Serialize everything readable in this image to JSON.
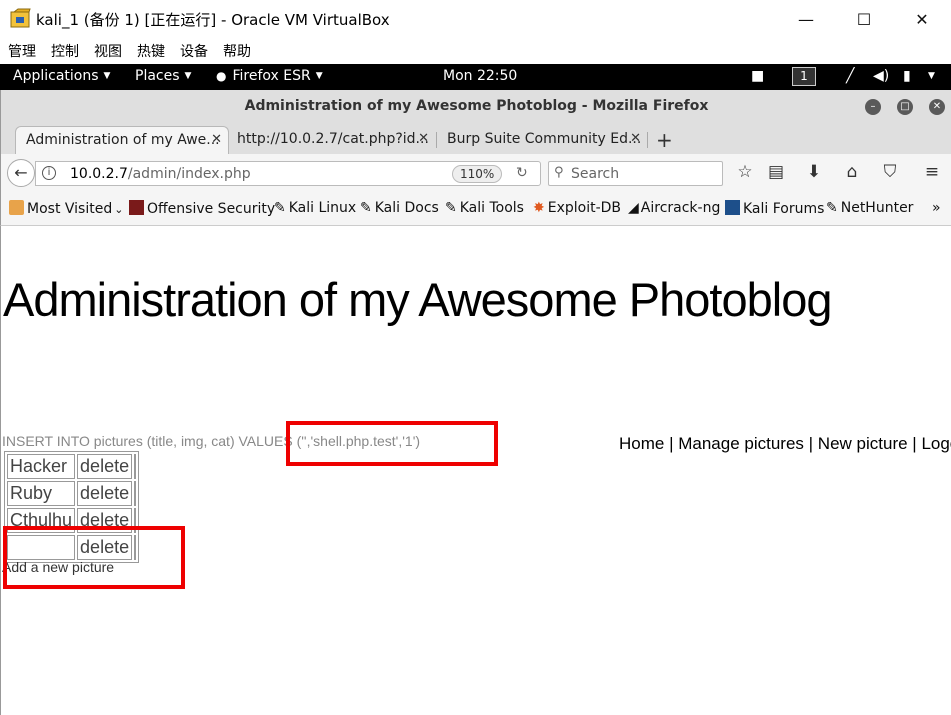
{
  "vbox": {
    "title": "kali_1 (备份 1) [正在运行] - Oracle VM VirtualBox",
    "menu": [
      "管理",
      "控制",
      "视图",
      "热键",
      "设备",
      "帮助"
    ],
    "minimize": "—",
    "maximize": "☐",
    "close": "✕"
  },
  "gnome": {
    "applications": "Applications",
    "places": "Places",
    "firefox": "Firefox ESR",
    "clock": "Mon 22:50",
    "workspace": "1"
  },
  "firefox": {
    "window_title": "Administration of my Awesome Photoblog - Mozilla Firefox",
    "tabs": [
      {
        "label": "Administration of my Awe..."
      },
      {
        "label": "http://10.0.2.7/cat.php?id..."
      },
      {
        "label": "Burp Suite Community Ed..."
      }
    ],
    "url_host": "10.0.2.7",
    "url_path": "/admin/index.php",
    "zoom": "110%",
    "search_placeholder": "Search",
    "bookmarks": [
      "Most Visited",
      "Offensive Security",
      "Kali Linux",
      "Kali Docs",
      "Kali Tools",
      "Exploit-DB",
      "Aircrack-ng",
      "Kali Forums",
      "NetHunter"
    ],
    "overflow": "»"
  },
  "page": {
    "title": "Administration of my Awesome Photoblog",
    "sql": "INSERT INTO pictures (title, img, cat) VALUES ('','shell.php.test','1')",
    "nav": [
      "Home",
      "Manage pictures",
      "New picture",
      "Logo"
    ],
    "separator": " | ",
    "rows": [
      {
        "title": "Hacker",
        "action": "delete"
      },
      {
        "title": "Ruby",
        "action": "delete"
      },
      {
        "title": "Cthulhu",
        "action": "delete"
      },
      {
        "title": "",
        "action": "delete"
      }
    ],
    "add_link": "Add a new picture"
  },
  "colors": {
    "highlight": "#e00000",
    "gnome_bar": "#000000",
    "chrome": "#dfdfdf"
  }
}
